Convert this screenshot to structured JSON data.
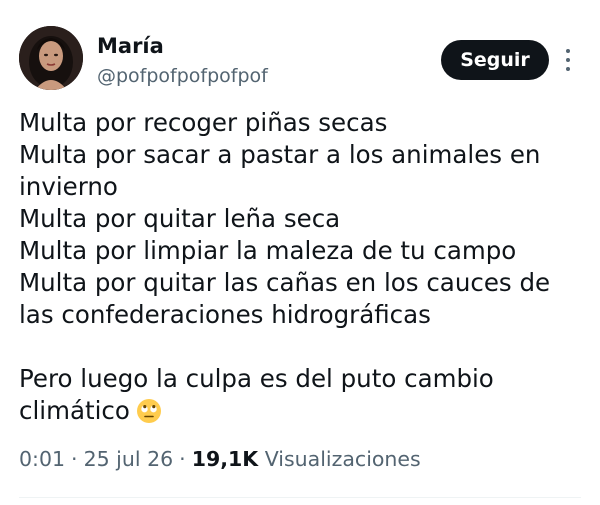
{
  "author": {
    "display_name": "María",
    "handle": "@pofpofpofpofpof"
  },
  "follow_button": {
    "label": "Seguir"
  },
  "more_button": {
    "icon": "more-vertical-icon"
  },
  "tweet": {
    "lines": [
      "Multa por recoger piñas secas",
      "Multa por sacar a pastar a los animales en",
      "invierno",
      "Multa por quitar leña seca",
      "Multa por limpiar la maleza de tu campo",
      "Multa por quitar las cañas en los cauces de",
      "las confederaciones hidrográficas",
      "",
      "Pero luego la culpa es del puto cambio",
      "climático"
    ],
    "emoji": "eye-roll-emoji-icon"
  },
  "meta": {
    "time": "0:01",
    "separator": "·",
    "date": "25 jul 26",
    "views_count": "19,1K",
    "views_label": "Visualizaciones"
  },
  "colors": {
    "text_primary": "#0f1419",
    "text_secondary": "#536471",
    "button_bg": "#0f1419",
    "button_text": "#ffffff",
    "divider": "#eff3f4"
  }
}
